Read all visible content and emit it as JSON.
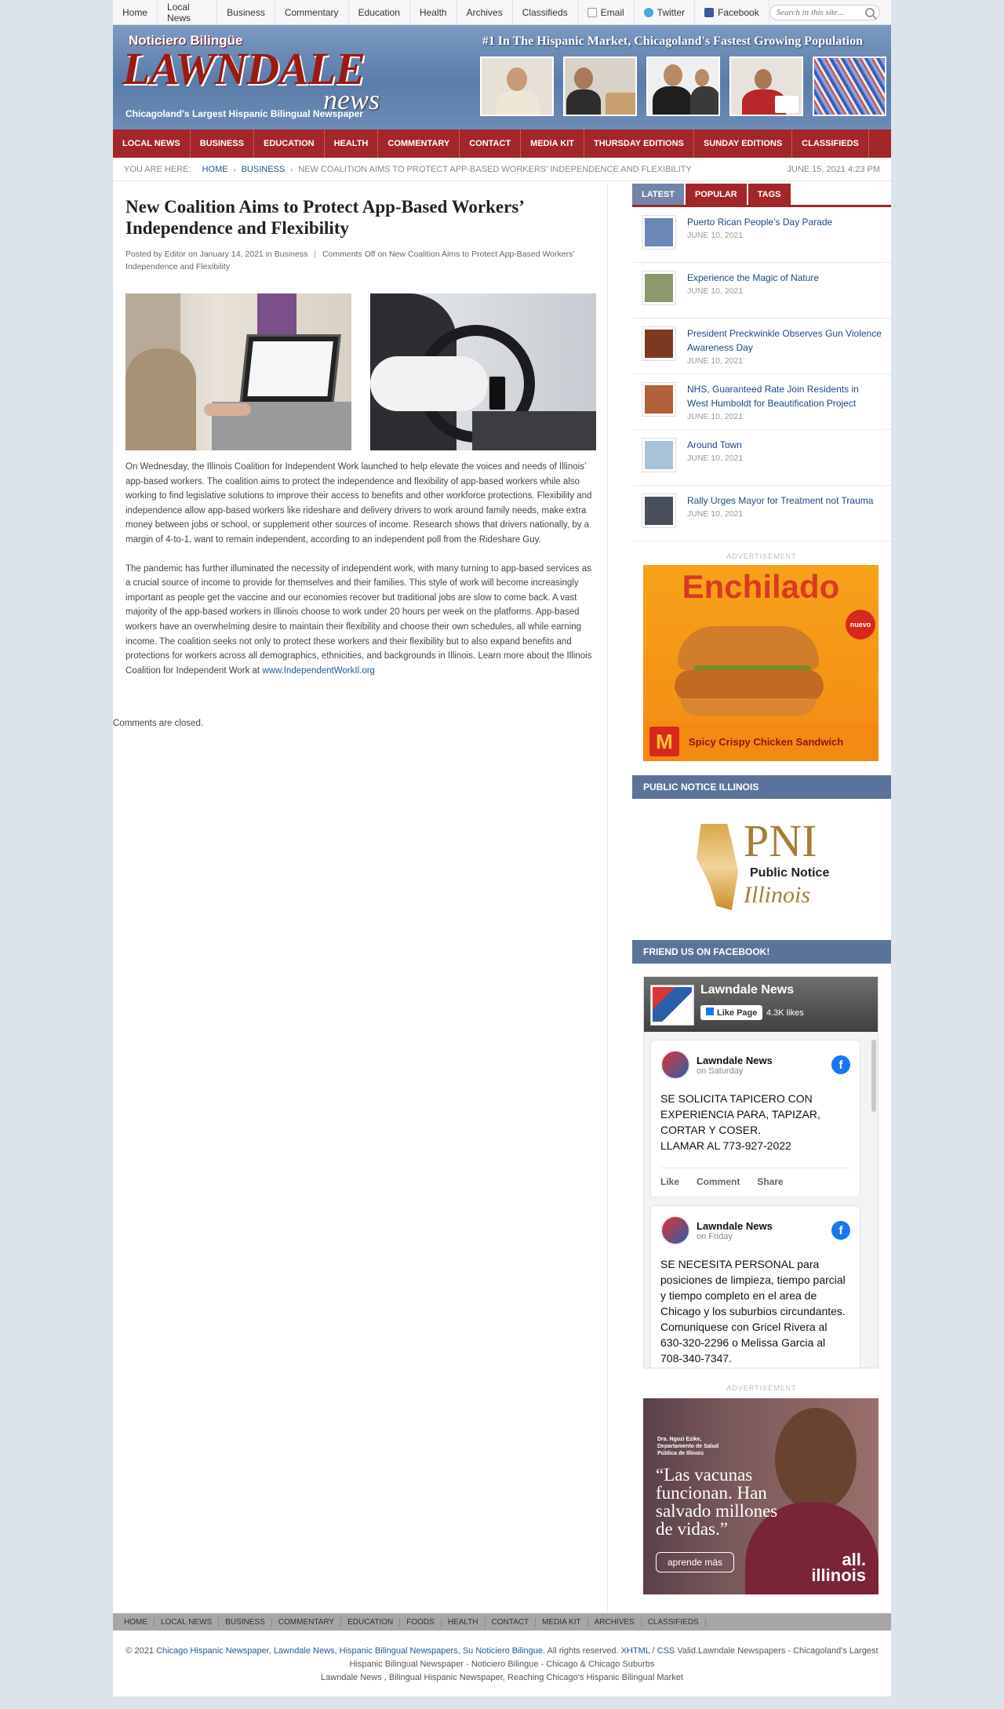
{
  "topnav": {
    "items": [
      "Home",
      "Local News",
      "Business",
      "Commentary",
      "Education",
      "Health",
      "Archives",
      "Classifieds"
    ],
    "social": [
      {
        "label": "Email",
        "icon": "mail-icon"
      },
      {
        "label": "Twitter",
        "icon": "twitter-icon"
      },
      {
        "label": "Facebook",
        "icon": "facebook-icon"
      }
    ],
    "search_placeholder": "Search in this site..."
  },
  "header": {
    "logo_small": "Noticiero Bilingüe",
    "logo_big": "LAWNDALE",
    "logo_news": "news",
    "logo_tagline": "Chicagoland's Largest Hispanic Bilingual Newspaper",
    "tagline": "#1 In The Hispanic Market, Chicagoland's Fastest Growing Population"
  },
  "mainnav": [
    "LOCAL NEWS",
    "BUSINESS",
    "EDUCATION",
    "HEALTH",
    "COMMENTARY",
    "CONTACT",
    "MEDIA KIT",
    "THURSDAY EDITIONS",
    "SUNDAY EDITIONS",
    "CLASSIFIEDS"
  ],
  "breadcrumb": {
    "prefix": "YOU ARE HERE:",
    "home": "HOME",
    "section": "BUSINESS",
    "current": "NEW COALITION AIMS TO PROTECT APP-BASED WORKERS' INDEPENDENCE AND FLEXIBILITY",
    "date": "JUNE 15, 2021 4:23 PM"
  },
  "article": {
    "title": "New Coalition Aims to Protect App-Based Workers’ Independence and Flexibility",
    "meta_posted": "Posted by",
    "meta_author": "Editor",
    "meta_on": "on January 14, 2021 in",
    "meta_category": "Business",
    "meta_comments": "Comments Off on New Coalition Aims to Protect App-Based Workers’ Independence and Flexibility",
    "para1": "On Wednesday, the Illinois Coalition for Independent Work launched to help elevate the voices and needs of Illinois’ app-based workers. The coalition aims to protect the independence and flexibility of app-based workers while also working to find legislative solutions to improve their access to benefits and other workforce protections. Flexibility and independence allow app-based workers like rideshare and delivery drivers to work around family needs, make extra money between jobs or school, or supplement other sources of income. Research shows that drivers nationally, by a margin of 4-to-1, want to remain independent, according to an independent poll from the Rideshare Guy.",
    "para2": "The pandemic has further illuminated the necessity of independent work, with many turning to app-based services as a crucial source of income to provide for themselves and their families.  This style of work will become increasingly important as people get the vaccine and our economies recover but traditional jobs are slow to come back. A vast majority of the app-based workers in Illinois choose to work under 20 hours per week on the platforms. App-based workers have an overwhelming desire to maintain their flexibility and choose their own schedules, all while earning income. The coalition seeks not only to protect these workers and their flexibility but to also expand benefits and protections for workers across all demographics, ethnicities, and backgrounds in Illinois. Learn more about the Illinois Coalition for Independent Work at",
    "link": "www.IndependentWorkIl.org",
    "comments_closed": "Comments are closed."
  },
  "sidebar": {
    "tabs": [
      "LATEST",
      "POPULAR",
      "TAGS"
    ],
    "posts": [
      {
        "title": "Puerto Rican People’s Day Parade",
        "date": "JUNE 10, 2021",
        "color": "#6c86b5"
      },
      {
        "title": "Experience the Magic of Nature",
        "date": "JUNE 10, 2021",
        "color": "#8a9a6a"
      },
      {
        "title": "President Preckwinkle Observes Gun Violence Awareness Day",
        "date": "JUNE 10, 2021",
        "color": "#7a3a22"
      },
      {
        "title": "NHS, Guaranteed Rate Join Residents in West Humboldt for Beautification Project",
        "date": "JUNE 10, 2021",
        "color": "#b0603a"
      },
      {
        "title": "Around Town",
        "date": "JUNE 10, 2021",
        "color": "#a8c2d8"
      },
      {
        "title": "Rally Urges Mayor for Treatment not Trauma",
        "date": "JUNE 10, 2021",
        "color": "#4a4f5c"
      }
    ],
    "ad_label": "ADVERTISEMENT",
    "ad1": {
      "headline": "Enchilado",
      "badge": "nuevo",
      "caption": "Spicy Crispy Chicken Sandwich",
      "logo": "M"
    },
    "pni_heading": "PUBLIC NOTICE ILLINOIS",
    "pni": {
      "abbr": "PNI",
      "line1": "Public Notice",
      "line2": "Illinois"
    },
    "fb_heading": "FRIEND US ON FACEBOOK!",
    "fb": {
      "page_name": "Lawndale News",
      "like_label": "Like Page",
      "likes": "4.3K likes",
      "posts": [
        {
          "name": "Lawndale News",
          "when": "on Saturday",
          "text": "SE SOLICITA TAPICERO CON EXPERIENCIA PARA, TAPIZAR, CORTAR Y COSER.\nLLAMAR AL 773-927-2022"
        },
        {
          "name": "Lawndale News",
          "when": "on Friday",
          "text": "SE NECESITA PERSONAL para posiciones de limpieza, tiempo parcial y tiempo completo en el area de Chicago y los suburbios circundantes. Comuniquese con Gricel Rivera al 630-320-2296 o Melissa Garcia al 708-340-7347."
        }
      ],
      "actions": [
        "Like",
        "Comment",
        "Share"
      ]
    },
    "ad2": {
      "credit": "Dra. Ngozi Ezike, Departamento de Salud Pública de Illinois",
      "quote": "“Las vacunas funcionan. Han salvado millones de vidas.”",
      "button": "aprende más",
      "brand_top": "all.",
      "brand_bottom": "illinois"
    }
  },
  "footer": {
    "nav": [
      "HOME",
      "LOCAL NEWS",
      "BUSINESS",
      "COMMENTARY",
      "EDUCATION",
      "FOODS",
      "HEALTH",
      "CONTACT",
      "MEDIA KIT",
      "ARCHIVES",
      "CLASSIFIEDS"
    ],
    "copyright_prefix": "© 2021",
    "links": [
      "Chicago Hispanic Newspaper",
      "Lawndale News",
      "Hispanic Bilingual Newspapers",
      "Su Noticiero Bilingue"
    ],
    "rights": ". All rights reserved.",
    "valid_links": [
      "XHTML",
      "CSS"
    ],
    "valid_text": "Valid.Lawndale Newspapers - Chicagoland's Largest Hispanic Bilingual Newspaper - Noticiero Bilingue - Chicago & Chicago Suburbs",
    "line3": "Lawndale News , Bilingual Hispanic Newspaper, Reaching Chicago's Hispanic Bilingual Market"
  },
  "colors": {
    "brand_red": "#a3262a",
    "nav_blue": "#5c7399",
    "link": "#1e5a8a"
  }
}
